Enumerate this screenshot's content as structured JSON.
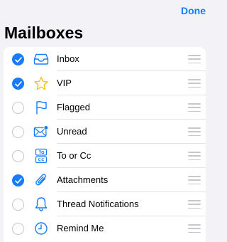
{
  "header": {
    "done_label": "Done",
    "title": "Mailboxes"
  },
  "colors": {
    "accent": "#1a7cf5",
    "vip_star": "#f5c518",
    "unread_dot": "#1a7cf5",
    "background": "#f2f2f7",
    "separator": "#e3e3e8"
  },
  "mailboxes": [
    {
      "label": "Inbox",
      "icon": "inbox-tray-icon",
      "checked": true
    },
    {
      "label": "VIP",
      "icon": "star-icon",
      "checked": true
    },
    {
      "label": "Flagged",
      "icon": "flag-icon",
      "checked": false
    },
    {
      "label": "Unread",
      "icon": "unread-envelope-icon",
      "checked": false
    },
    {
      "label": "To or Cc",
      "icon": "to-cc-icon",
      "checked": false
    },
    {
      "label": "Attachments",
      "icon": "paperclip-icon",
      "checked": true
    },
    {
      "label": "Thread Notifications",
      "icon": "bell-icon",
      "checked": false
    },
    {
      "label": "Remind Me",
      "icon": "clock-icon",
      "checked": false
    }
  ]
}
